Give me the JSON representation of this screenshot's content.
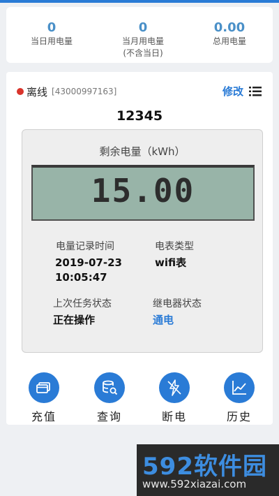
{
  "stats": [
    {
      "value": "0",
      "label": "当日用电量",
      "sub": ""
    },
    {
      "value": "0",
      "label": "当月用电量",
      "sub": "(不含当日)"
    },
    {
      "value": "0.00",
      "label": "总用电量",
      "sub": ""
    }
  ],
  "status": {
    "text": "离线",
    "meter_id": "[43000997163]",
    "edit_label": "修改",
    "color": "#d9342b"
  },
  "meter_name": "12345",
  "panel": {
    "title": "剩余电量（kWh）",
    "remaining": "15.00",
    "record_time_label": "电量记录时间",
    "record_date": "2019-07-23",
    "record_time": "10:05:47",
    "meter_type_label": "电表类型",
    "meter_type": "wifi表",
    "last_task_label": "上次任务状态",
    "last_task": "正在操作",
    "relay_label": "继电器状态",
    "relay": "通电"
  },
  "buttons": [
    {
      "label": "充值",
      "icon": "card-icon"
    },
    {
      "label": "查询",
      "icon": "database-search-icon"
    },
    {
      "label": "断电",
      "icon": "lightning-off-icon"
    },
    {
      "label": "历史",
      "icon": "chart-icon"
    }
  ],
  "watermark": {
    "logo_num": "592",
    "logo_text": "软件园",
    "url": "www.592xiazai.com"
  },
  "colors": {
    "accent": "#2a7bd6",
    "lcd": "#98b4a8"
  }
}
